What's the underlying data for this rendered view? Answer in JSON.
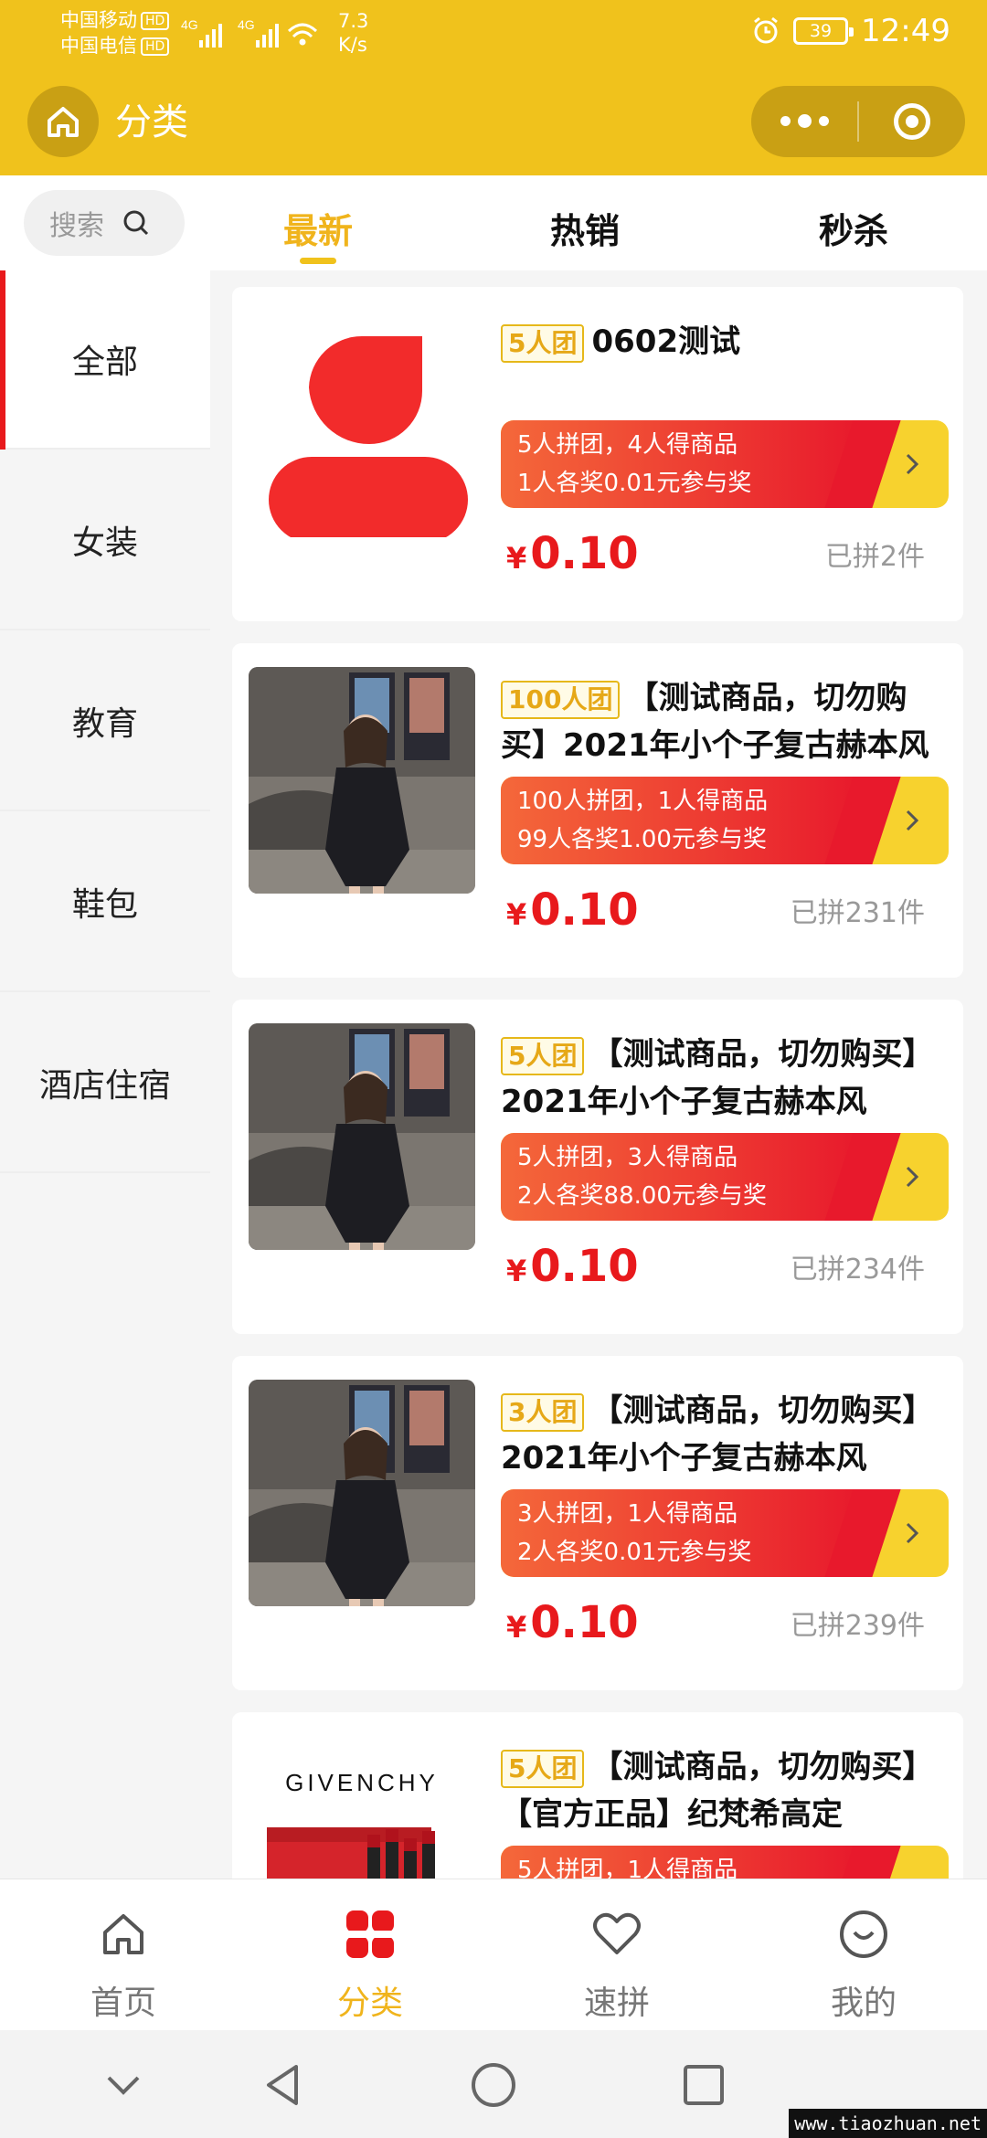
{
  "status_bar": {
    "carrier1": "中国移动",
    "carrier2": "中国电信",
    "hd": "HD",
    "network": "4G",
    "speed_value": "7.3",
    "speed_unit": "K/s",
    "battery": "39",
    "time": "12:49"
  },
  "title_bar": {
    "title": "分类"
  },
  "search": {
    "placeholder": "搜索"
  },
  "tabs": [
    {
      "label": "最新",
      "active": true
    },
    {
      "label": "热销",
      "active": false
    },
    {
      "label": "秒杀",
      "active": false
    }
  ],
  "sidebar": {
    "items": [
      {
        "label": "全部",
        "active": true
      },
      {
        "label": "女装",
        "active": false
      },
      {
        "label": "教育",
        "active": false
      },
      {
        "label": "鞋包",
        "active": false
      },
      {
        "label": "酒店住宿",
        "active": false
      }
    ]
  },
  "products": [
    {
      "tag": "5人团",
      "title": "0602测试",
      "promo_line1": "5人拼团，4人得商品",
      "promo_line2": "1人各奖0.01元参与奖",
      "currency": "¥",
      "price": "0.10",
      "sold": "已拼2件",
      "image": "red-logo"
    },
    {
      "tag": "100人团",
      "title": "【测试商品，切勿购买】2021年小个子复古赫本风",
      "promo_line1": "100人拼团，1人得商品",
      "promo_line2": "99人各奖1.00元参与奖",
      "currency": "¥",
      "price": "0.10",
      "sold": "已拼231件",
      "image": "dress-photo"
    },
    {
      "tag": "5人团",
      "title": "【测试商品，切勿购买】2021年小个子复古赫本风",
      "promo_line1": "5人拼团，3人得商品",
      "promo_line2": "2人各奖88.00元参与奖",
      "currency": "¥",
      "price": "0.10",
      "sold": "已拼234件",
      "image": "dress-photo"
    },
    {
      "tag": "3人团",
      "title": "【测试商品，切勿购买】2021年小个子复古赫本风",
      "promo_line1": "3人拼团，1人得商品",
      "promo_line2": "2人各奖0.01元参与奖",
      "currency": "¥",
      "price": "0.10",
      "sold": "已拼239件",
      "image": "dress-photo"
    },
    {
      "tag": "5人团",
      "title": "【测试商品，切勿购买】【官方正品】纪梵希高定",
      "promo_line1": "5人拼团，1人得商品",
      "promo_line2": "",
      "currency": "¥",
      "price": "",
      "sold": "",
      "image": "givenchy-photo",
      "brand_text": "GIVENCHY"
    }
  ],
  "tabbar": {
    "items": [
      {
        "label": "首页",
        "icon": "home-icon",
        "active": false
      },
      {
        "label": "分类",
        "icon": "category-icon",
        "active": true
      },
      {
        "label": "速拼",
        "icon": "heart-icon",
        "active": false
      },
      {
        "label": "我的",
        "icon": "smile-icon",
        "active": false
      }
    ]
  },
  "watermark": "www.tiaozhuan.net",
  "colors": {
    "brand_yellow": "#f0c21c",
    "accent_red": "#e8191c",
    "active_tab": "#f0b41c"
  }
}
